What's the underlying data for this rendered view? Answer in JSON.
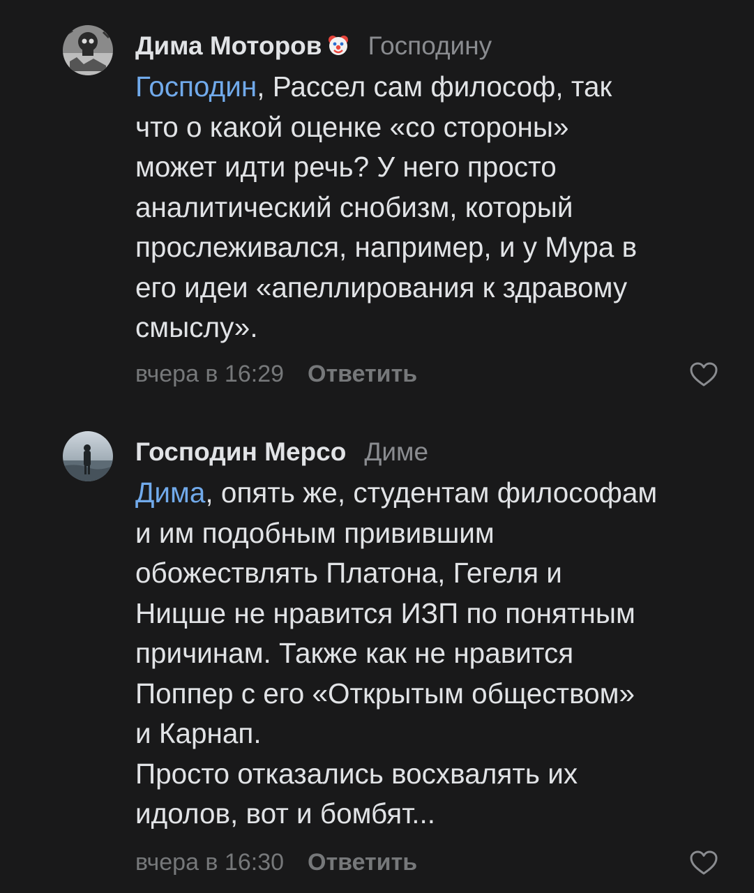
{
  "comments": [
    {
      "author": "Дима Моторов",
      "reply_to": "Господину",
      "mention": "Господин",
      "text_lines": [
        ", Рассел сам философ, так",
        "что о какой оценке «со стороны»",
        "может идти речь? У него просто",
        "аналитический снобизм, который",
        "прослеживался, например, и у Мура в",
        "его идеи «апеллирования к здравому",
        "смыслу»."
      ],
      "time": "вчера в 16:29",
      "reply_label": "Ответить"
    },
    {
      "author": "Господин Мерсо",
      "reply_to": "Диме",
      "mention": "Дима",
      "text_lines": [
        ", опять же, студентам философам",
        "и им подобным привившим",
        "обожествлять Платона, Гегеля и",
        "Ницше не нравится ИЗП по понятным",
        "причинам. Также как не нравится",
        "Поппер с его «Открытым обществом»",
        "и Карнап.",
        "Просто отказались восхвалять их",
        "идолов, вот и бомбят..."
      ],
      "time": "вчера в 16:30",
      "reply_label": "Ответить"
    }
  ],
  "colors": {
    "background": "#19191a",
    "text": "#e1e3e6",
    "secondary": "#76787a",
    "link": "#71aaeb"
  },
  "icons": [
    "avatar",
    "clown-emoji-icon",
    "heart-icon"
  ]
}
